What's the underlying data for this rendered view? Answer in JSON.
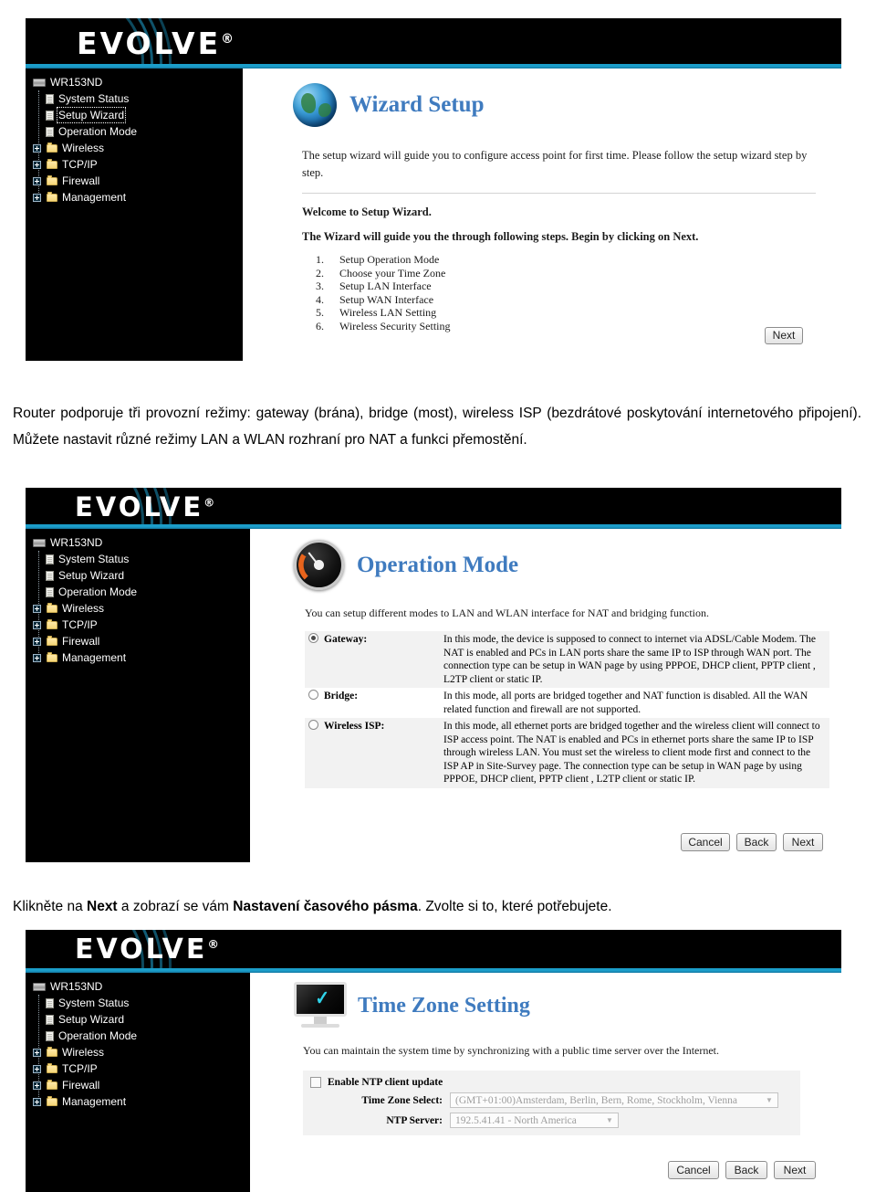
{
  "document": {
    "captions": [
      {
        "id": "caption-operation-modes",
        "segments": [
          {
            "text": "Router podporuje tři provozní režimy: gateway (brána), bridge (most), wireless ISP (bezdrátové poskytování internetového připojení). Můžete nastavit různé režimy LAN a WLAN rozhraní pro NAT a funkci přemostění.",
            "bold": false
          }
        ]
      },
      {
        "id": "caption-time-zone",
        "segments": [
          {
            "text": "Klikněte na ",
            "bold": false
          },
          {
            "text": "Next",
            "bold": true
          },
          {
            "text": " a zobrazí se vám ",
            "bold": false
          },
          {
            "text": "Nastavení časového pásma",
            "bold": true
          },
          {
            "text": ". Zvolte si to, které potřebujete.",
            "bold": false
          }
        ]
      }
    ]
  },
  "brand": {
    "logo_text": "EVOLVE",
    "registered_mark": "®",
    "accent_color": "#1b9dc9"
  },
  "sidebar": {
    "root": {
      "label": "WR153ND",
      "icon": "router-icon"
    },
    "items": [
      {
        "label": "System Status",
        "icon": "page-icon",
        "selected": false,
        "expandable": false
      },
      {
        "label": "Setup Wizard",
        "icon": "page-icon",
        "selected": true,
        "expandable": false
      },
      {
        "label": "Operation Mode",
        "icon": "page-icon",
        "selected": false,
        "expandable": false
      },
      {
        "label": "Wireless",
        "icon": "folder-icon",
        "selected": false,
        "expandable": true
      },
      {
        "label": "TCP/IP",
        "icon": "folder-icon",
        "selected": false,
        "expandable": true
      },
      {
        "label": "Firewall",
        "icon": "folder-icon",
        "selected": false,
        "expandable": true
      },
      {
        "label": "Management",
        "icon": "folder-icon",
        "selected": false,
        "expandable": true
      }
    ]
  },
  "screen_wizard": {
    "title": "Wizard Setup",
    "title_icon": "globe-icon",
    "intro": "The setup wizard will guide you to configure access point for first time. Please follow the setup wizard step by step.",
    "welcome": "Welcome to Setup Wizard.",
    "begin": "The Wizard will guide you the through following steps. Begin by clicking on Next.",
    "steps": [
      {
        "num": "1.",
        "label": "Setup Operation Mode"
      },
      {
        "num": "2.",
        "label": "Choose your Time Zone"
      },
      {
        "num": "3.",
        "label": "Setup LAN Interface"
      },
      {
        "num": "4.",
        "label": "Setup WAN Interface"
      },
      {
        "num": "5.",
        "label": "Wireless LAN Setting"
      },
      {
        "num": "6.",
        "label": "Wireless Security Setting"
      }
    ],
    "buttons": [
      {
        "label": "Next",
        "name": "next-button"
      }
    ]
  },
  "screen_operation_mode": {
    "title": "Operation Mode",
    "title_icon": "gauge-icon",
    "intro": "You can setup different modes to LAN and WLAN interface for NAT and bridging function.",
    "options": [
      {
        "label": "Gateway:",
        "selected": true,
        "description": "In this mode, the device is supposed to connect to internet via ADSL/Cable Modem. The NAT is enabled and PCs in LAN ports share the same IP to ISP through WAN port. The connection type can be setup in WAN page by using PPPOE, DHCP client, PPTP client , L2TP client or static IP."
      },
      {
        "label": "Bridge:",
        "selected": false,
        "description": "In this mode, all ports are bridged together and NAT function is disabled. All the WAN related function and firewall are not supported."
      },
      {
        "label": "Wireless ISP:",
        "selected": false,
        "description": "In this mode, all ethernet ports are bridged together and the wireless client will connect to ISP access point. The NAT is enabled and PCs in ethernet ports share the same IP to ISP through wireless LAN. You must set the wireless to client mode first and connect to the ISP AP in Site-Survey page. The connection type can be setup in WAN page by using PPPOE, DHCP client, PPTP client , L2TP client or static IP."
      }
    ],
    "buttons": [
      {
        "label": "Cancel",
        "name": "cancel-button"
      },
      {
        "label": "Back",
        "name": "back-button"
      },
      {
        "label": "Next",
        "name": "next-button"
      }
    ]
  },
  "screen_time_zone": {
    "title": "Time Zone Setting",
    "title_icon": "monitor-icon",
    "intro": "You can maintain the system time by synchronizing with a public time server over the Internet.",
    "enable_ntp": {
      "label": "Enable NTP client update",
      "checked": false
    },
    "time_zone": {
      "label": "Time Zone Select:",
      "value": "(GMT+01:00)Amsterdam, Berlin, Bern, Rome, Stockholm, Vienna",
      "disabled": true
    },
    "ntp_server": {
      "label": "NTP Server:",
      "value": "192.5.41.41 - North America",
      "disabled": true
    },
    "buttons": [
      {
        "label": "Cancel",
        "name": "cancel-button"
      },
      {
        "label": "Back",
        "name": "back-button"
      },
      {
        "label": "Next",
        "name": "next-button"
      }
    ]
  }
}
